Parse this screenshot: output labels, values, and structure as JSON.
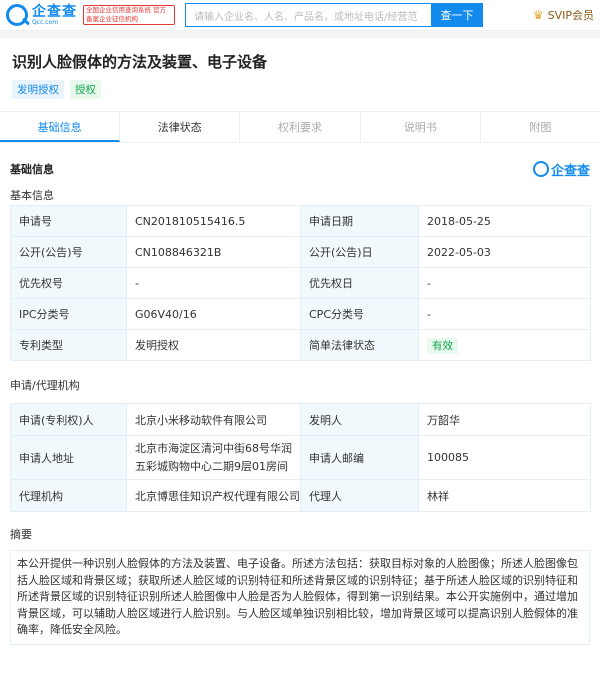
{
  "header": {
    "logo_cn": "企查查",
    "logo_en": "Qcc.com",
    "gov_badge": "全国企业信用查询系统 官方备案企业征信机构",
    "search_placeholder": "请输入企业名、人名、产品名，或地址电话/经营范",
    "search_button": "查一下",
    "vip_label": "SVIP会员"
  },
  "title": "识别人脸假体的方法及装置、电子设备",
  "tags": [
    "发明授权",
    "授权"
  ],
  "tabs": [
    "基础信息",
    "法律状态",
    "权利要求",
    "说明书",
    "附图"
  ],
  "section": {
    "title": "基础信息",
    "brand": "企查查"
  },
  "basic": {
    "subtitle": "基本信息",
    "rows": [
      [
        "申请号",
        "CN201810515416.5",
        "申请日期",
        "2018-05-25"
      ],
      [
        "公开(公告)号",
        "CN108846321B",
        "公开(公告)日",
        "2022-05-03"
      ],
      [
        "优先权号",
        "-",
        "优先权日",
        "-"
      ],
      [
        "IPC分类号",
        "G06V40/16",
        "CPC分类号",
        "-"
      ],
      [
        "专利类型",
        "发明授权",
        "简单法律状态",
        "有效"
      ]
    ]
  },
  "agency": {
    "subtitle": "申请/代理机构",
    "applicant_label": "申请(专利权)人",
    "applicant": "北京小米移动软件有限公司",
    "inventor_label": "发明人",
    "inventor": "万韶华",
    "address_label": "申请人地址",
    "address": "北京市海淀区清河中街68号华润五彩城购物中心二期9层01房间",
    "postcode_label": "申请人邮编",
    "postcode": "100085",
    "agency_label": "代理机构",
    "agency": "北京博思佳知识产权代理有限公司",
    "agent_label": "代理人",
    "agent": "林祥"
  },
  "abstract": {
    "title": "摘要",
    "text": "本公开提供一种识别人脸假体的方法及装置、电子设备。所述方法包括：获取目标对象的人脸图像；所述人脸图像包括人脸区域和背景区域；获取所述人脸区域的识别特征和所述背景区域的识别特征；基于所述人脸区域的识别特征和所述背景区域的识别特征识别所述人脸图像中人脸是否为人脸假体，得到第一识别结果。本公开实施例中，通过增加背景区域，可以辅助人脸区域进行人脸识别。与人脸区域单独识别相比较，增加背景区域可以提高识别人脸假体的准确率，降低安全风险。"
  },
  "colors": {
    "accent": "#128bed",
    "status_green": "#11a551",
    "label_bg": "#f2f9fc"
  }
}
